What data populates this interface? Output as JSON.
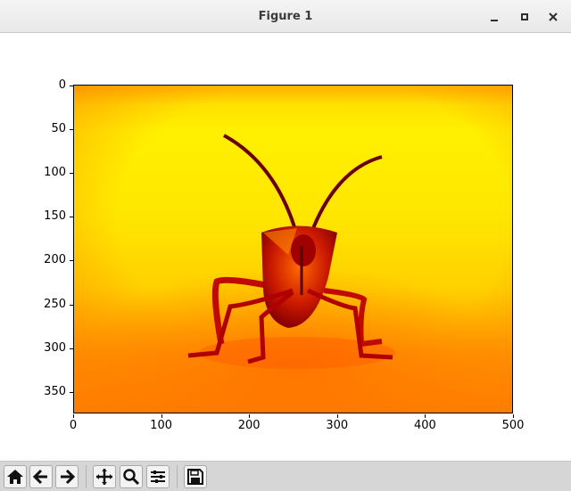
{
  "window": {
    "title": "Figure 1"
  },
  "figure": {
    "image_description_icon": "insect-image",
    "yticks": [
      "0",
      "50",
      "100",
      "150",
      "200",
      "250",
      "300",
      "350"
    ],
    "xticks": [
      "0",
      "100",
      "200",
      "300",
      "400",
      "500"
    ]
  },
  "toolbar": {
    "buttons": [
      "home-icon",
      "back-icon",
      "forward-icon",
      "pan-icon",
      "zoom-icon",
      "configure-subplots-icon",
      "save-icon"
    ]
  }
}
